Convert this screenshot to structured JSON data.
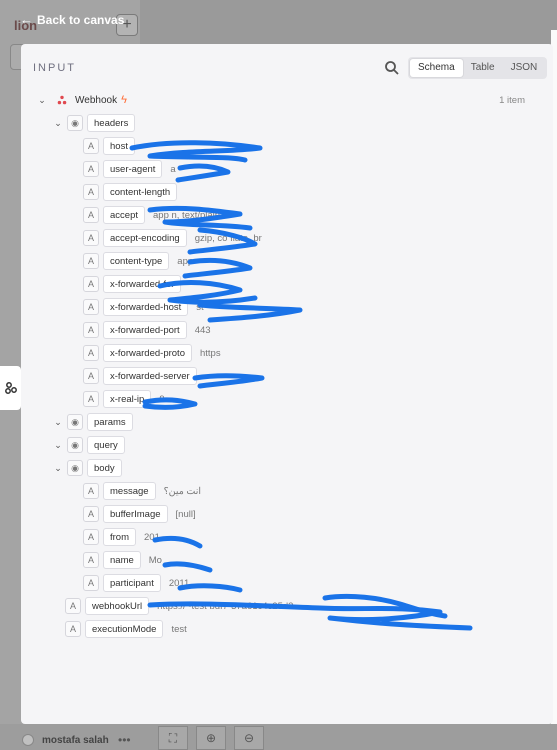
{
  "nav": {
    "back_label": "Back to canvas"
  },
  "canvas": {
    "workflow_name": "lion",
    "add_label": "+"
  },
  "panel": {
    "title": "INPUT",
    "views": [
      {
        "label": "Schema",
        "active": true
      },
      {
        "label": "Table",
        "active": false
      },
      {
        "label": "JSON",
        "active": false
      }
    ],
    "node_name": "Webhook",
    "item_count": "1 item"
  },
  "tree": {
    "headers": {
      "label": "headers",
      "fields": [
        {
          "key": "host",
          "value": ""
        },
        {
          "key": "user-agent",
          "value": "a"
        },
        {
          "key": "content-length",
          "value": ""
        },
        {
          "key": "accept",
          "value": "app          n, text/plain, */*"
        },
        {
          "key": "accept-encoding",
          "value": "gzip, co            flate, br"
        },
        {
          "key": "content-type",
          "value": "app"
        },
        {
          "key": "x-forwarded-for",
          "value": ""
        },
        {
          "key": "x-forwarded-host",
          "value": "                                st"
        },
        {
          "key": "x-forwarded-port",
          "value": "443"
        },
        {
          "key": "x-forwarded-proto",
          "value": "https"
        },
        {
          "key": "x-forwarded-server",
          "value": ""
        },
        {
          "key": "x-real-ip",
          "value": "9"
        }
      ]
    },
    "params": {
      "label": "params"
    },
    "query": {
      "label": "query"
    },
    "body": {
      "label": "body",
      "fields": [
        {
          "key": "message",
          "value": "انت مين؟"
        },
        {
          "key": "bufferImage",
          "value": "[null]"
        },
        {
          "key": "from",
          "value": "201"
        },
        {
          "key": "name",
          "value": "Mo"
        },
        {
          "key": "participant",
          "value": "2011"
        }
      ]
    },
    "webhookUrl": {
      "key": "webhookUrl",
      "value": "https://                                      -test                  bdf7-37a61c4c25d2"
    },
    "executionMode": {
      "key": "executionMode",
      "value": "test"
    }
  },
  "footer": {
    "user_name": "mostafa salah",
    "menu_label": "•••"
  },
  "icons": {
    "back": "arrow-left-icon",
    "search": "search-icon",
    "string_type": "text-type-icon",
    "object_type": "cube-icon",
    "webhook": "webhook-icon",
    "trigger": "lightning-bolt-icon",
    "fit": "fit-view-icon",
    "zoom_in": "zoom-in-icon",
    "zoom_out": "zoom-out-icon"
  },
  "colors": {
    "accent": "#ff6b35",
    "redaction": "#1a73e8"
  }
}
